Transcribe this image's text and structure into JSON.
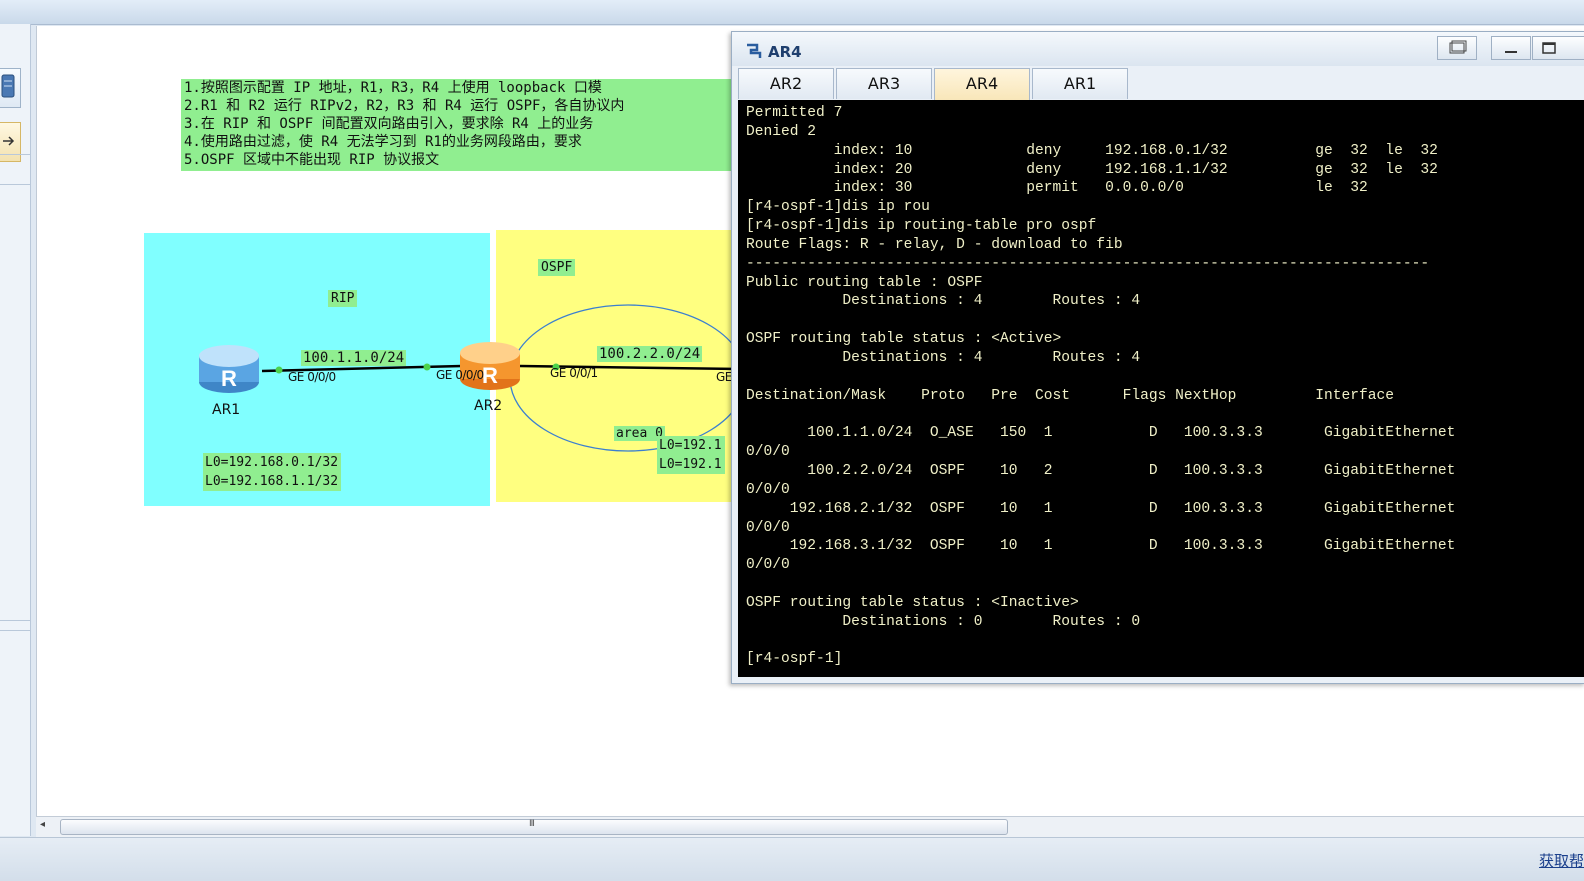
{
  "task_list": [
    "1.按照图示配置 IP 地址，R1，R3，R4 上使用 loopback 口模",
    "2.R1 和 R2 运行 RIPv2，R2，R3 和 R4 运行 OSPF，各自协议内",
    "3.在 RIP 和 OSPF 间配置双向路由引入，要求除 R4 上的业务",
    "4.使用路由过滤，使 R4 无法学习到 R1的业务网段路由，要求",
    "5.OSPF 区域中不能出现 RIP 协议报文"
  ],
  "topology": {
    "rip_label": "RIP",
    "ospf_label": "OSPF",
    "area_label": "area 0",
    "link1_subnet": "100.1.1.0/24",
    "link2_subnet": "100.2.2.0/24",
    "ar1": {
      "name": "AR1",
      "port": "GE 0/0/0",
      "loopbacks": [
        "L0=192.168.0.1/32",
        "L0=192.168.1.1/32"
      ]
    },
    "ar2": {
      "name": "AR2",
      "port_left": "GE 0/0/0",
      "port_right": "GE 0/0/1"
    },
    "ar3_partial": {
      "port": "GE",
      "loopbacks": [
        "L0=192.1",
        "L0=192.1"
      ]
    }
  },
  "terminal": {
    "title": "AR4",
    "tabs": [
      "AR2",
      "AR3",
      "AR4",
      "AR1"
    ],
    "active_tab": "AR4",
    "lines": [
      "Permitted 7",
      "Denied 2",
      "          index: 10             deny     192.168.0.1/32          ge  32  le  32",
      "          index: 20             deny     192.168.1.1/32          ge  32  le  32",
      "          index: 30             permit   0.0.0.0/0               le  32",
      "[r4-ospf-1]dis ip rou",
      "[r4-ospf-1]dis ip routing-table pro ospf",
      "Route Flags: R - relay, D - download to fib",
      "------------------------------------------------------------------------------",
      "Public routing table : OSPF",
      "           Destinations : 4        Routes : 4",
      "",
      "OSPF routing table status : <Active>",
      "           Destinations : 4        Routes : 4",
      "",
      "Destination/Mask    Proto   Pre  Cost      Flags NextHop         Interface",
      "",
      "       100.1.1.0/24  O_ASE   150  1           D   100.3.3.3       GigabitEthernet",
      "0/0/0",
      "       100.2.2.0/24  OSPF    10   2           D   100.3.3.3       GigabitEthernet",
      "0/0/0",
      "     192.168.2.1/32  OSPF    10   1           D   100.3.3.3       GigabitEthernet",
      "0/0/0",
      "     192.168.3.1/32  OSPF    10   1           D   100.3.3.3       GigabitEthernet",
      "0/0/0",
      "",
      "OSPF routing table status : <Inactive>",
      "           Destinations : 0        Routes : 0",
      "",
      "[r4-ospf-1]"
    ]
  },
  "hscroll_grip": "III",
  "status_link": "获取帮"
}
